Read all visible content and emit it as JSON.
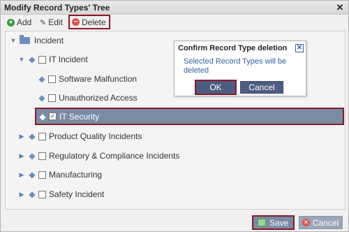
{
  "window": {
    "title": "Modify Record Types' Tree",
    "close_glyph": "✕"
  },
  "toolbar": {
    "add_label": "Add",
    "edit_label": "Edit",
    "delete_label": "Delete"
  },
  "tree": {
    "root": {
      "label": "Incident",
      "expanded": true
    },
    "nodes": [
      {
        "label": "IT Incident",
        "expanded": true,
        "checked": false
      },
      {
        "label": "Software Malfunction",
        "checked": false
      },
      {
        "label": "Unauthorized Access",
        "checked": false
      },
      {
        "label": "IT Security",
        "checked": true,
        "selected": true
      },
      {
        "label": "Product Quality Incidents",
        "expanded": false,
        "checked": false
      },
      {
        "label": "Regulatory & Compliance Incidents",
        "expanded": false,
        "checked": false
      },
      {
        "label": "Manufacturing",
        "expanded": false,
        "checked": false
      },
      {
        "label": "Safety Incident",
        "expanded": false,
        "checked": false
      }
    ]
  },
  "footer": {
    "save_label": "Save",
    "cancel_label": "Cancel"
  },
  "dialog": {
    "title": "Confirm Record Type deletion",
    "message": "Selected Record Types will be deleted",
    "ok_label": "OK",
    "cancel_label": "Cancel",
    "close_glyph": "✕"
  },
  "colors": {
    "highlight_border": "#8b1a2b",
    "selected_row_bg": "#7a8ba4",
    "dialog_button_bg": "#4c5d80",
    "tree_icon": "#6a8fbf",
    "message_text": "#2f5fa3"
  }
}
